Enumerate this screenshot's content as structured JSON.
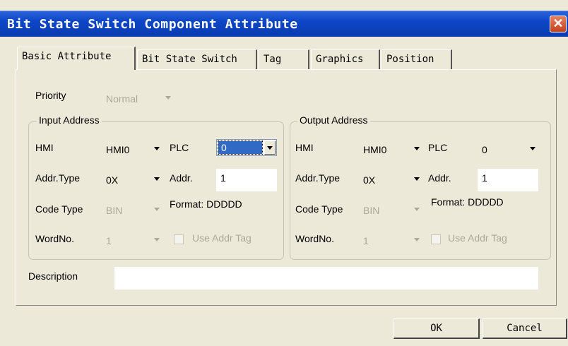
{
  "window": {
    "title": "Bit State Switch Component Attribute",
    "close_glyph": "✕"
  },
  "tabs": [
    {
      "label": "Basic Attribute",
      "active": true
    },
    {
      "label": "Bit State Switch",
      "active": false
    },
    {
      "label": "Tag",
      "active": false
    },
    {
      "label": "Graphics",
      "active": false
    },
    {
      "label": "Position",
      "active": false
    }
  ],
  "priority": {
    "label": "Priority",
    "value": "Normal"
  },
  "input_address": {
    "title": "Input Address",
    "hmi_label": "HMI",
    "hmi_value": "HMI0",
    "plc_label": "PLC",
    "plc_value": "0",
    "addr_type_label": "Addr.Type",
    "addr_type_value": "0X",
    "addr_label": "Addr.",
    "addr_value": "1",
    "code_type_label": "Code Type",
    "code_type_value": "BIN",
    "format_text": "Format:  DDDDD",
    "word_no_label": "WordNo.",
    "word_no_value": "1",
    "use_addr_tag_label": "Use Addr Tag"
  },
  "output_address": {
    "title": "Output Address",
    "hmi_label": "HMI",
    "hmi_value": "HMI0",
    "plc_label": "PLC",
    "plc_value": "0",
    "addr_type_label": "Addr.Type",
    "addr_type_value": "0X",
    "addr_label": "Addr.",
    "addr_value": "1",
    "code_type_label": "Code Type",
    "code_type_value": "BIN",
    "format_text": "Format:  DDDDD",
    "word_no_label": "WordNo.",
    "word_no_value": "1",
    "use_addr_tag_label": "Use Addr Tag"
  },
  "description": {
    "label": "Description",
    "value": ""
  },
  "buttons": {
    "ok": "OK",
    "cancel": "Cancel"
  },
  "colors": {
    "titlebar": "#0d46c6",
    "face": "#ece9d8",
    "selection": "#316ac5",
    "close": "#c6411b"
  }
}
